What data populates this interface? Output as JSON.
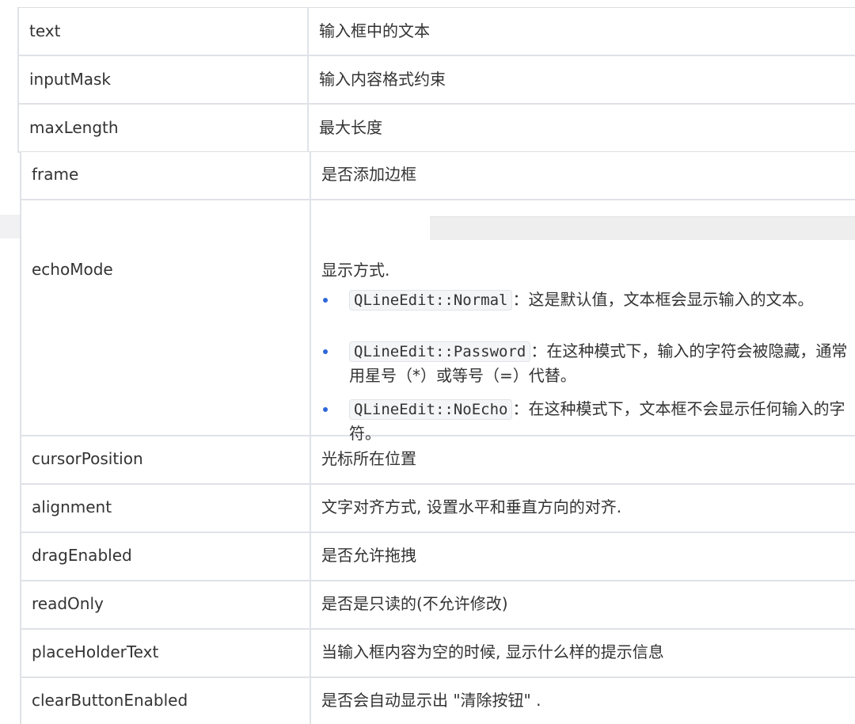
{
  "table_top": {
    "rows": [
      {
        "property": "text",
        "description": "输入框中的文本"
      },
      {
        "property": "inputMask",
        "description": "输入内容格式约束"
      },
      {
        "property": "maxLength",
        "description": "最大长度"
      }
    ]
  },
  "table_bottom": {
    "rows": [
      {
        "property": "frame",
        "description": "是否添加边框"
      },
      {
        "property": "echoMode",
        "description": "显示方式.",
        "modes": [
          {
            "code": "QLineEdit::Normal",
            "text": "：这是默认值，文本框会显示输入的文本。"
          },
          {
            "code": "QLineEdit::Password",
            "text": "：在这种模式下，输入的字符会被隐藏，通常用星号（*）或等号（=）代替。"
          },
          {
            "code": "QLineEdit::NoEcho",
            "text": "：在这种模式下，文本框不会显示任何输入的字符。"
          }
        ]
      },
      {
        "property": "cursorPosition",
        "description": "光标所在位置"
      },
      {
        "property": "alignment",
        "description": "文字对齐方式, 设置水平和垂直方向的对齐."
      },
      {
        "property": "dragEnabled",
        "description": "是否允许拖拽"
      },
      {
        "property": "readOnly",
        "description": "是否是只读的(不允许修改)"
      },
      {
        "property": "placeHolderText",
        "description": "当输入框内容为空的时候, 显示什么样的提示信息"
      },
      {
        "property": "clearButtonEnabled",
        "description": "是否会自动显示出 \"清除按钮\" ."
      }
    ]
  },
  "colors": {
    "border": "#dfe2e7",
    "bullet": "#2f67d9",
    "code_bg": "#f4f5f7"
  }
}
